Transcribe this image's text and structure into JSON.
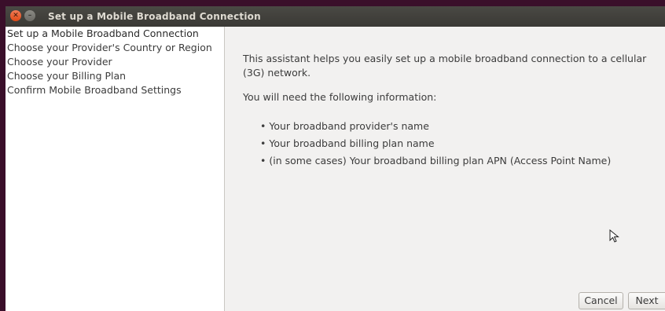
{
  "window": {
    "title": "Set up a Mobile Broadband Connection",
    "controls": {
      "close_icon": "close-icon",
      "minimize_icon": "minimize-icon"
    }
  },
  "sidebar": {
    "items": [
      {
        "label": "Set up a Mobile Broadband Connection",
        "active": true
      },
      {
        "label": "Choose your Provider's Country or Region",
        "active": false
      },
      {
        "label": "Choose your Provider",
        "active": false
      },
      {
        "label": "Choose your Billing Plan",
        "active": false
      },
      {
        "label": "Confirm Mobile Broadband Settings",
        "active": false
      }
    ]
  },
  "main": {
    "intro": "This assistant helps you easily set up a mobile broadband connection to a cellular (3G) network.",
    "need_label": "You will need the following information:",
    "bullets": [
      "• Your broadband provider's name",
      "• Your broadband billing plan name",
      "• (in some cases) Your broadband billing plan APN (Access Point Name)"
    ]
  },
  "buttons": {
    "cancel": "Cancel",
    "next": "Next"
  },
  "colors": {
    "titlebar": "#3c3b37",
    "close_button": "#e95420",
    "desktop": "#3a0f2a"
  }
}
